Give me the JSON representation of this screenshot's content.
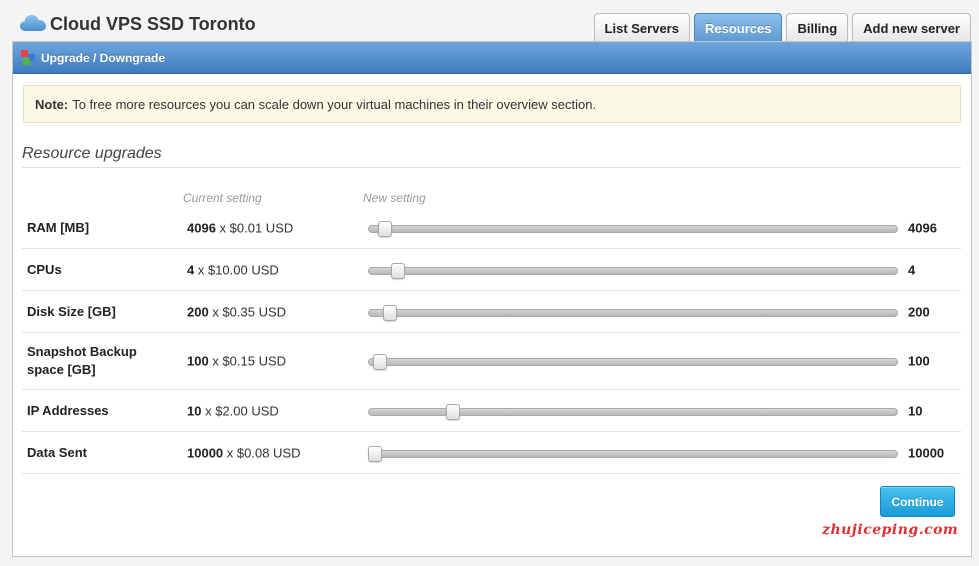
{
  "app": {
    "title": "Cloud VPS SSD Toronto"
  },
  "tabs": [
    {
      "label": "List Servers",
      "active": false
    },
    {
      "label": "Resources",
      "active": true
    },
    {
      "label": "Billing",
      "active": false
    },
    {
      "label": "Add new server",
      "active": false
    }
  ],
  "panel": {
    "title": "Upgrade / Downgrade"
  },
  "note": {
    "label": "Note:",
    "text": "To free more resources you can scale down your virtual machines in their overview section."
  },
  "section": {
    "title": "Resource upgrades"
  },
  "columns": {
    "current": "Current setting",
    "new": "New setting"
  },
  "resources": [
    {
      "label": "RAM [MB]",
      "qty": "4096",
      "price": "x $0.01 USD",
      "value": "4096",
      "slider_fraction": 0.03
    },
    {
      "label": "CPUs",
      "qty": "4",
      "price": "x $10.00 USD",
      "value": "4",
      "slider_fraction": 0.055
    },
    {
      "label": "Disk Size [GB]",
      "qty": "200",
      "price": "x $0.35 USD",
      "value": "200",
      "slider_fraction": 0.04
    },
    {
      "label": "Snapshot Backup space [GB]",
      "qty": "100",
      "price": "x $0.15 USD",
      "value": "100",
      "slider_fraction": 0.02
    },
    {
      "label": "IP Addresses",
      "qty": "10",
      "price": "x $2.00 USD",
      "value": "10",
      "slider_fraction": 0.16
    },
    {
      "label": "Data Sent",
      "qty": "10000",
      "price": "x $0.08 USD",
      "value": "10000",
      "slider_fraction": 0.012
    }
  ],
  "actions": {
    "continue_label": "Continue"
  },
  "watermark": "zhujiceping.com",
  "colors": {
    "tab_active": "#5c99d2",
    "panel_header": "#3f7cbf",
    "continue_button": "#1a9bd7",
    "watermark": "#e03030"
  }
}
